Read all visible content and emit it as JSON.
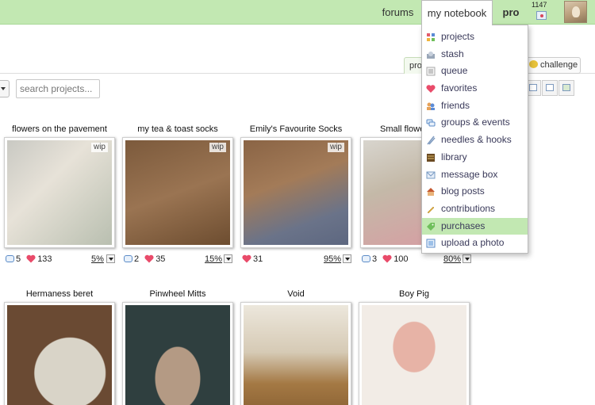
{
  "topnav": {
    "forums": "forums",
    "my_notebook": "my notebook",
    "pro": "pro",
    "message_count": "1147"
  },
  "content": {
    "tab_partial": "pro",
    "challenge": "challenge",
    "search_placeholder": "search projects..."
  },
  "projects": [
    {
      "title": "flowers on the pavement",
      "wip": "wip",
      "comments": "5",
      "favorites": "133",
      "progress": "5%"
    },
    {
      "title": "my tea & toast socks",
      "wip": "wip",
      "comments": "2",
      "favorites": "35",
      "progress": "15%"
    },
    {
      "title": "Emily's Favourite Socks",
      "wip": "wip",
      "comments": "",
      "favorites": "31",
      "progress": "95%"
    },
    {
      "title": "Small flowe",
      "wip": "",
      "comments": "3",
      "favorites": "100",
      "progress": "80%"
    },
    {
      "title": "Hermaness beret"
    },
    {
      "title": "Pinwheel Mitts"
    },
    {
      "title": "Void"
    },
    {
      "title": "Boy Pig"
    }
  ],
  "menu": {
    "items": [
      {
        "label": "projects",
        "icon": "projects-icon"
      },
      {
        "label": "stash",
        "icon": "stash-icon"
      },
      {
        "label": "queue",
        "icon": "queue-icon"
      },
      {
        "label": "favorites",
        "icon": "heart-icon"
      },
      {
        "label": "friends",
        "icon": "friends-icon"
      },
      {
        "label": "groups & events",
        "icon": "groups-icon"
      },
      {
        "label": "needles & hooks",
        "icon": "needles-icon"
      },
      {
        "label": "library",
        "icon": "library-icon"
      },
      {
        "label": "message box",
        "icon": "message-icon"
      },
      {
        "label": "blog posts",
        "icon": "blog-icon"
      },
      {
        "label": "contributions",
        "icon": "pencil-icon"
      },
      {
        "label": "purchases",
        "icon": "purchases-icon"
      },
      {
        "label": "upload a photo",
        "icon": "upload-icon"
      }
    ],
    "active": "purchases"
  },
  "colors": {
    "nav_green": "#c2e8b2",
    "heart": "#e94b6a",
    "link": "#3a3a5a"
  }
}
